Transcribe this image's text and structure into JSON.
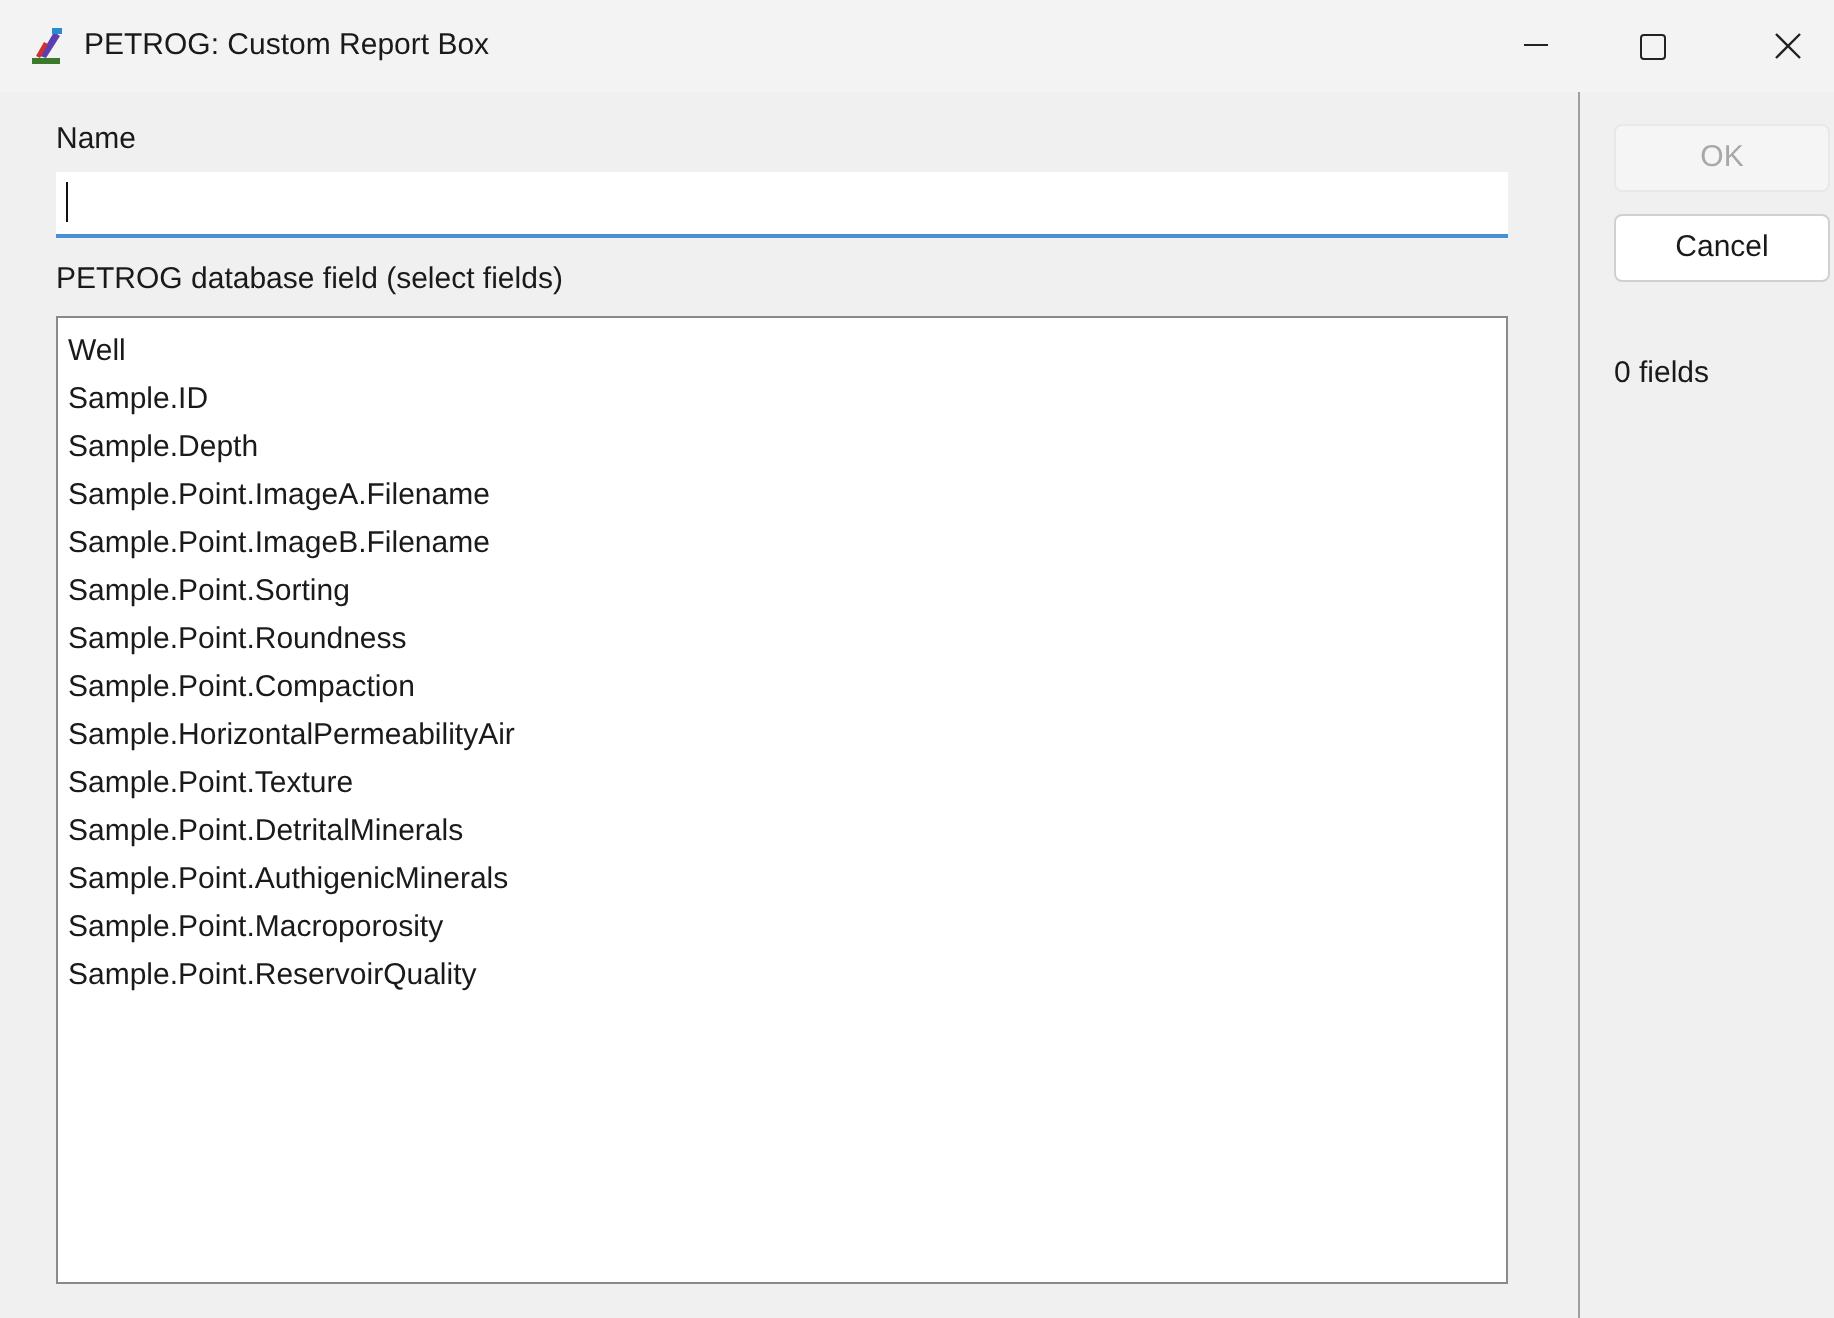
{
  "window": {
    "title": "PETROG: Custom Report Box"
  },
  "name_field": {
    "label": "Name",
    "focused": true
  },
  "field_list": {
    "label": "PETROG database field (select fields)",
    "items": [
      {
        "label": "Well",
        "selected": false
      },
      {
        "label": "Sample.ID",
        "selected": false
      },
      {
        "label": "Sample.Depth",
        "selected": false
      },
      {
        "label": "Sample.Point.ImageA.Filename",
        "selected": false
      },
      {
        "label": "Sample.Point.ImageB.Filename",
        "selected": false
      },
      {
        "label": "Sample.Point.Sorting",
        "selected": false
      },
      {
        "label": "Sample.Point.Roundness",
        "selected": false
      },
      {
        "label": "Sample.Point.Compaction",
        "selected": false
      },
      {
        "label": "Sample.HorizontalPermeabilityAir",
        "selected": false
      },
      {
        "label": "Sample.Point.Texture",
        "selected": false
      },
      {
        "label": "Sample.Point.DetritalMinerals",
        "selected": false
      },
      {
        "label": "Sample.Point.AuthigenicMinerals",
        "selected": false
      },
      {
        "label": "Sample.Point.Macroporosity",
        "selected": false
      },
      {
        "label": "Sample.Point.ReservoirQuality",
        "selected": false
      }
    ]
  },
  "buttons": [
    {
      "label": "OK",
      "disabled": true
    },
    {
      "label": "Cancel",
      "disabled": false
    }
  ],
  "field_count": "0 fields"
}
